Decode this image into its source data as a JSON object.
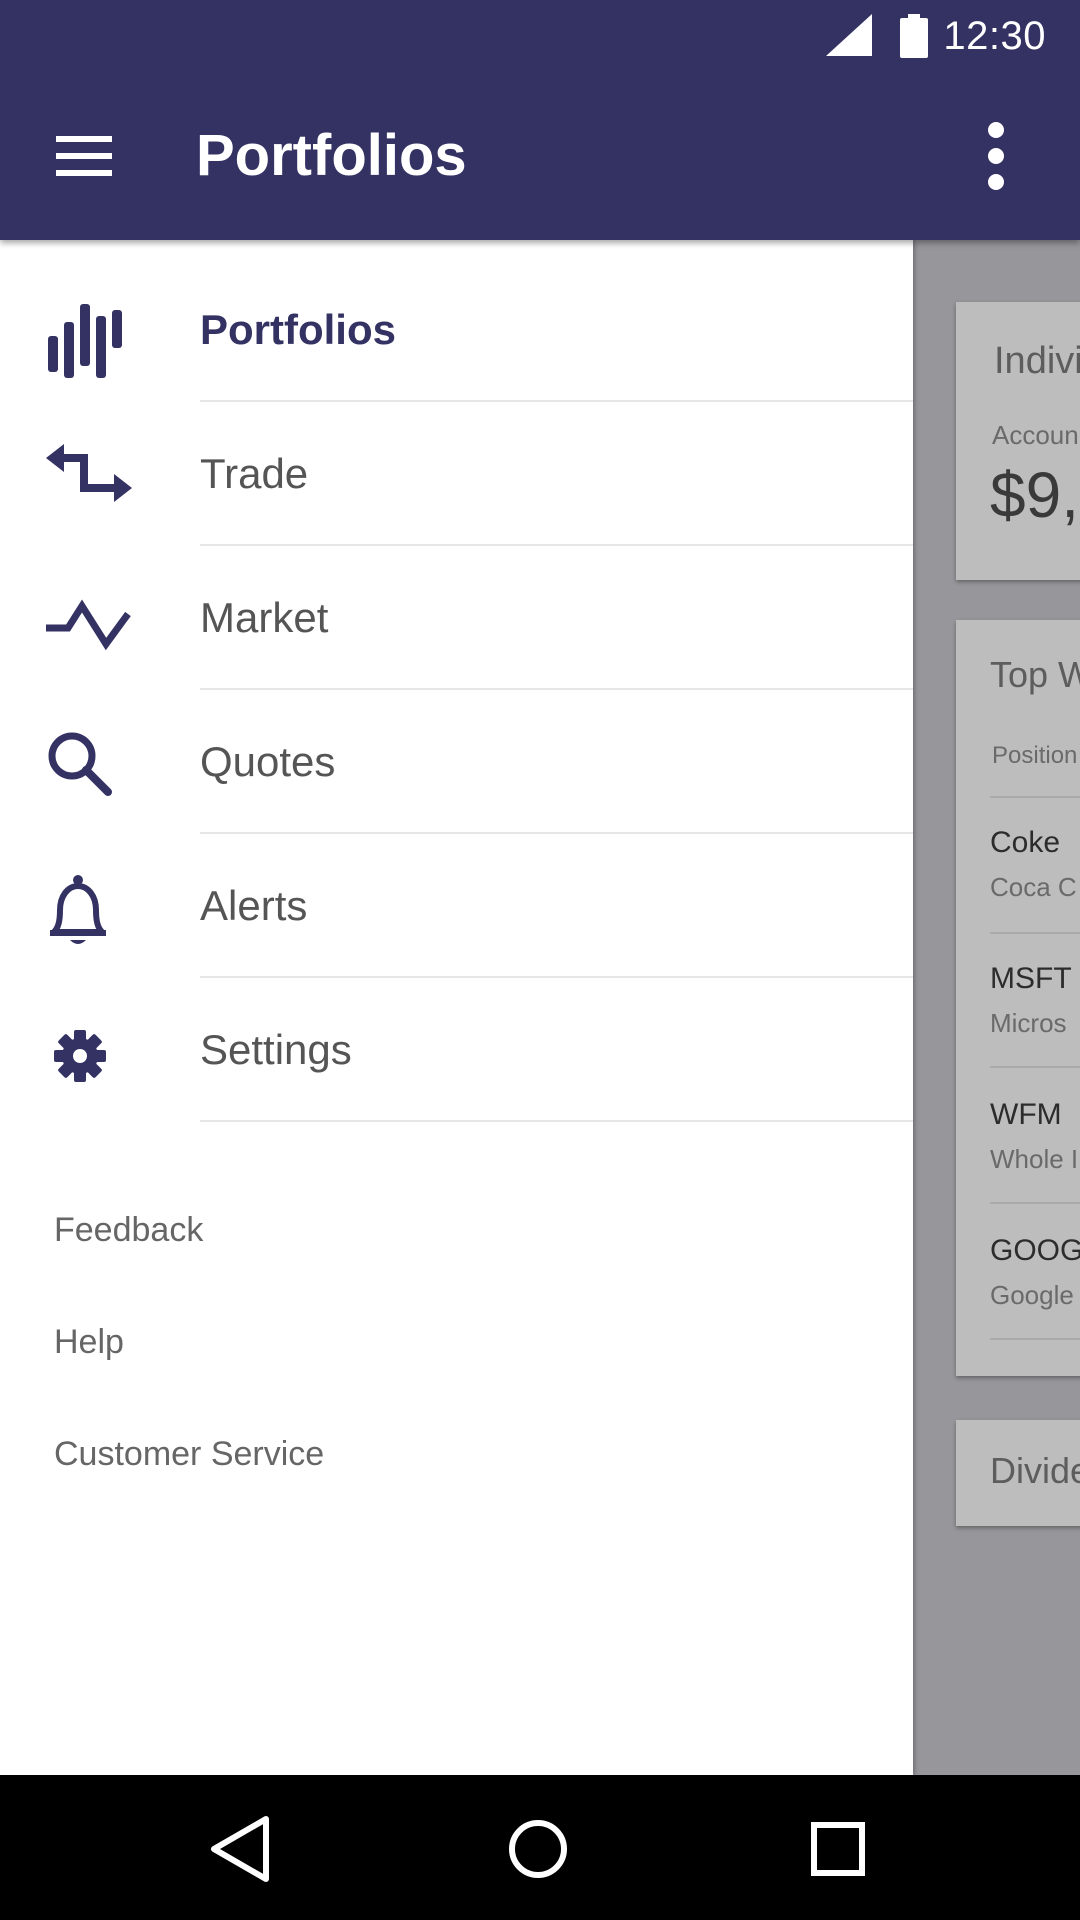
{
  "status_bar": {
    "time": "12:30",
    "icons": [
      "signal-icon",
      "battery-icon"
    ]
  },
  "app_bar": {
    "title": "Portfolios",
    "menu_icon": "menu-icon",
    "overflow_icon": "more-vert-icon"
  },
  "drawer": {
    "items": [
      {
        "label": "Portfolios",
        "icon": "portfolio-bars-icon",
        "active": true
      },
      {
        "label": "Trade",
        "icon": "swap-arrows-icon",
        "active": false
      },
      {
        "label": "Market",
        "icon": "trend-line-icon",
        "active": false
      },
      {
        "label": "Quotes",
        "icon": "search-icon",
        "active": false
      },
      {
        "label": "Alerts",
        "icon": "bell-icon",
        "active": false
      },
      {
        "label": "Settings",
        "icon": "gear-icon",
        "active": false
      }
    ],
    "secondary": [
      {
        "label": "Feedback"
      },
      {
        "label": "Help"
      },
      {
        "label": "Customer Service"
      }
    ]
  },
  "background": {
    "card1": {
      "heading": "Indivi",
      "label": "Accoun",
      "amount": "$9,("
    },
    "card2": {
      "heading": "Top W",
      "column": "Position",
      "rows": [
        {
          "symbol": "Coke",
          "name": "Coca C"
        },
        {
          "symbol": "MSFT",
          "name": "Micros"
        },
        {
          "symbol": "WFM",
          "name": "Whole I"
        },
        {
          "symbol": "GOOG",
          "name": "Google"
        }
      ]
    },
    "card3": {
      "heading": "Divide"
    }
  },
  "colors": {
    "primary": "#343263",
    "active_text": "#343263",
    "text": "#555555",
    "dim_overlay": "#97979b"
  },
  "system_nav": {
    "icons": [
      "back-icon",
      "home-icon",
      "recents-icon"
    ]
  }
}
